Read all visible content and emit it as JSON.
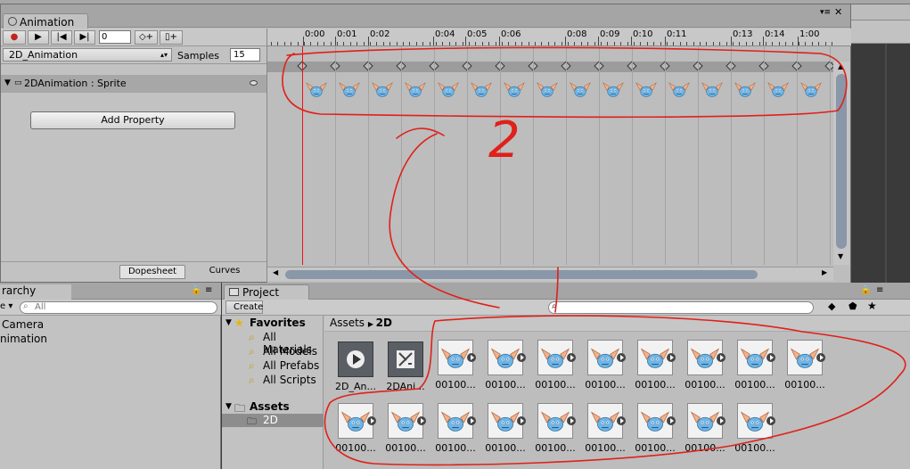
{
  "animation_window": {
    "tab_title": "Animation",
    "frame_value": "0",
    "clip_name": "2D_Animation",
    "samples_label": "Samples",
    "samples_value": "15",
    "property_name": "2DAnimation : Sprite",
    "add_property_label": "Add Property",
    "tab_dopesheet": "Dopesheet",
    "tab_curves": "Curves",
    "ruler_labels": [
      "0:00",
      "0:01",
      "0:02",
      "0:04",
      "0:05",
      "0:06",
      "0:08",
      "0:09",
      "0:10",
      "0:11",
      "0:13",
      "0:14",
      "1:00"
    ],
    "keyframe_count": 17
  },
  "hierarchy": {
    "tab_title": "rarchy",
    "create_label": "e",
    "search_placeholder": "All",
    "items": [
      "Camera",
      "nimation"
    ]
  },
  "project": {
    "tab_title": "Project",
    "create_label": "Create",
    "favorites_label": "Favorites",
    "favorites": [
      "All Materials",
      "All Models",
      "All Prefabs",
      "All Scripts"
    ],
    "assets_label": "Assets",
    "folder_2d": "2D",
    "breadcrumb_root": "Assets",
    "breadcrumb_current": "2D",
    "asset_items": [
      {
        "label": "2D_An...",
        "kind": "clip"
      },
      {
        "label": "2DAni...",
        "kind": "controller"
      },
      {
        "label": "00100...",
        "kind": "sprite"
      },
      {
        "label": "00100...",
        "kind": "sprite"
      },
      {
        "label": "00100...",
        "kind": "sprite"
      },
      {
        "label": "00100...",
        "kind": "sprite"
      },
      {
        "label": "00100...",
        "kind": "sprite"
      },
      {
        "label": "00100...",
        "kind": "sprite"
      },
      {
        "label": "00100...",
        "kind": "sprite"
      },
      {
        "label": "00100...",
        "kind": "sprite"
      },
      {
        "label": "00100...",
        "kind": "sprite"
      },
      {
        "label": "00100...",
        "kind": "sprite"
      },
      {
        "label": "00100...",
        "kind": "sprite"
      },
      {
        "label": "00100...",
        "kind": "sprite"
      },
      {
        "label": "00100...",
        "kind": "sprite"
      },
      {
        "label": "00100...",
        "kind": "sprite"
      },
      {
        "label": "00100...",
        "kind": "sprite"
      },
      {
        "label": "00100...",
        "kind": "sprite"
      },
      {
        "label": "00100...",
        "kind": "sprite"
      }
    ]
  },
  "annotation": {
    "number": "2",
    "color": "#e0201a"
  }
}
